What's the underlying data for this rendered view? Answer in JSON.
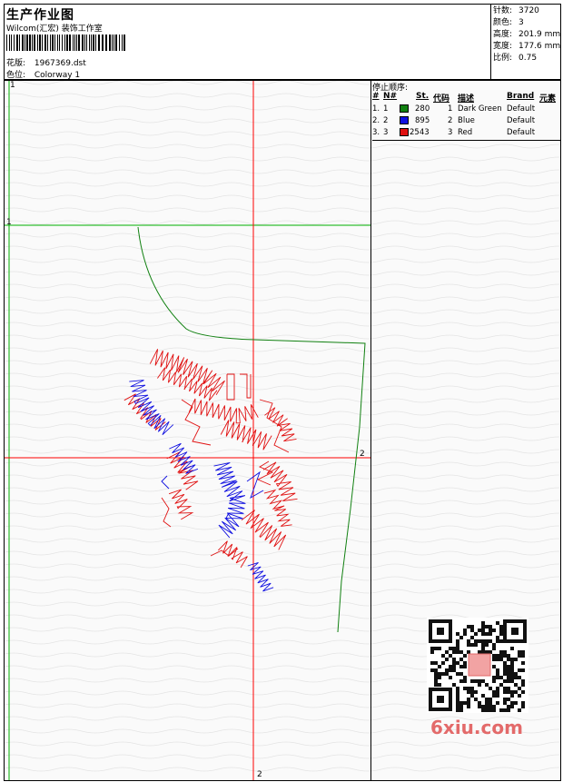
{
  "header": {
    "title": "生产作业图",
    "company": "Wilcom(汇宏) 装饰工作室",
    "design_label": "花版:",
    "design_value": "1967369.dst",
    "colorway_label": "色位:",
    "colorway_value": "Colorway 1"
  },
  "stats": [
    {
      "label": "针数:",
      "value": "3720"
    },
    {
      "label": "颜色:",
      "value": "3"
    },
    {
      "label": "高度:",
      "value": "201.9 mm"
    },
    {
      "label": "宽度:",
      "value": "177.6 mm"
    },
    {
      "label": "比例:",
      "value": "0.75"
    }
  ],
  "stop_sequence": {
    "title": "停止顺序:",
    "columns": [
      "#",
      "N#",
      "St.",
      "代码",
      "描述",
      "Brand",
      "元素"
    ],
    "rows": [
      {
        "index": "1.",
        "needle": "1",
        "stitches": "280",
        "code": "1",
        "description": "Dark Green",
        "brand": "Default",
        "color": "#108010"
      },
      {
        "index": "2.",
        "needle": "2",
        "stitches": "895",
        "code": "2",
        "description": "Blue",
        "brand": "Default",
        "color": "#1010e0"
      },
      {
        "index": "3.",
        "needle": "3",
        "stitches": "2543",
        "code": "3",
        "description": "Red",
        "brand": "Default",
        "color": "#e01010"
      }
    ]
  },
  "axis_labels": {
    "top_left_1": "1",
    "mid_left_1": "1",
    "right_2": "2",
    "bottom_2": "2"
  },
  "watermark": "6xiu.com",
  "colors": {
    "guide_red": "#ff0000",
    "guide_green": "#00b000",
    "stitch_red": "#e01010",
    "stitch_blue": "#1010e0",
    "stitch_green": "#108010"
  }
}
